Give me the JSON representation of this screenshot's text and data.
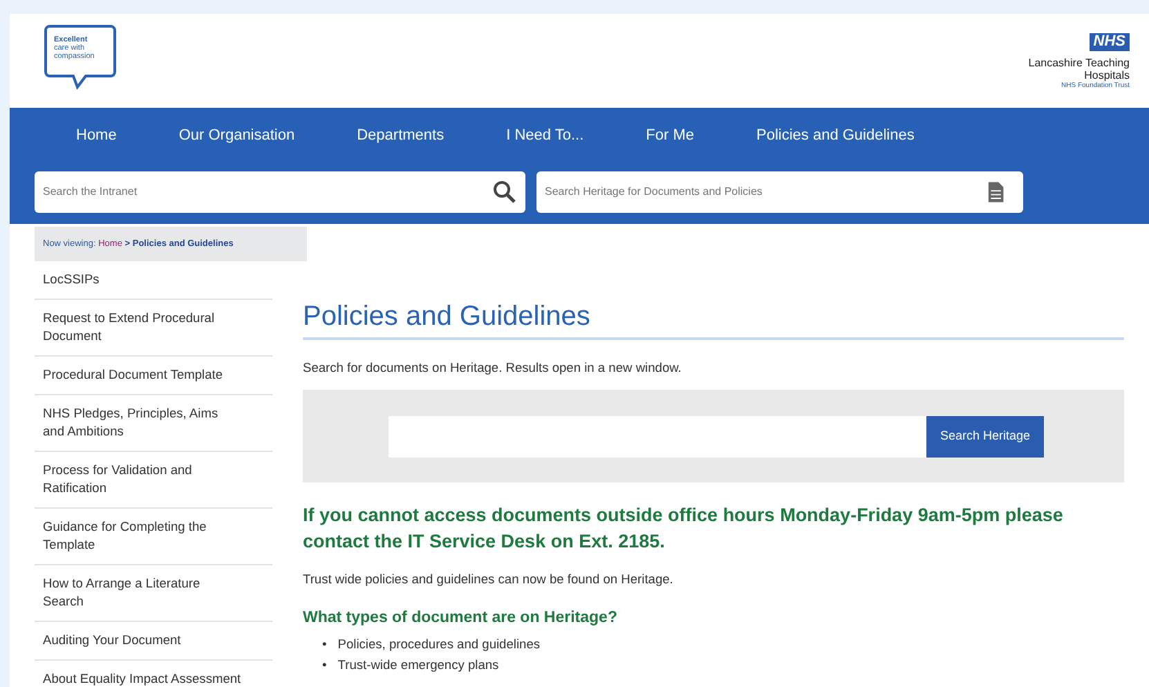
{
  "header": {
    "logo_text": [
      "Excellent",
      "care with",
      "compassion"
    ],
    "nhs_badge": "NHS",
    "trust_name": [
      "Lancashire Teaching",
      "Hospitals"
    ],
    "trust_subtitle": "NHS Foundation Trust"
  },
  "nav": {
    "items": [
      "Home",
      "Our Organisation",
      "Departments",
      "I Need To...",
      "For Me",
      "Policies and Guidelines"
    ]
  },
  "search": {
    "intranet_placeholder": "Search the Intranet",
    "heritage_placeholder": "Search Heritage for Documents and Policies"
  },
  "breadcrumb": {
    "prefix": "Now viewing:",
    "links": [
      "Home"
    ],
    "current": "> Policies and Guidelines"
  },
  "sidebar": {
    "items": [
      {
        "label": "LocSSIPs"
      },
      {
        "label": "Request to Extend Procedural Document"
      },
      {
        "label": "Procedural Document Template"
      },
      {
        "label": "NHS Pledges, Principles, Aims and Ambitions"
      },
      {
        "label": "Process for Validation and Ratification"
      },
      {
        "label": "Guidance for Completing the Template"
      },
      {
        "label": "How to Arrange a Literature Search"
      },
      {
        "label": "Auditing Your Document"
      },
      {
        "label": "About Equality Impact Assessment"
      }
    ]
  },
  "main": {
    "title": "Policies and Guidelines",
    "intro": "Search for documents on Heritage. Results open in a new window.",
    "search_button": "Search Heritage",
    "notice": "If you cannot access documents outside office hours Monday-Friday 9am-5pm please contact the IT Service Desk on Ext. 2185.",
    "paragraph": "Trust wide policies and guidelines can now be found on Heritage.",
    "subheading": "What types of document are on Heritage?",
    "bullets": [
      {
        "marker": "•",
        "text": "Policies, procedures and guidelines"
      },
      {
        "marker": "•",
        "text": "Trust-wide emergency plans"
      }
    ]
  }
}
